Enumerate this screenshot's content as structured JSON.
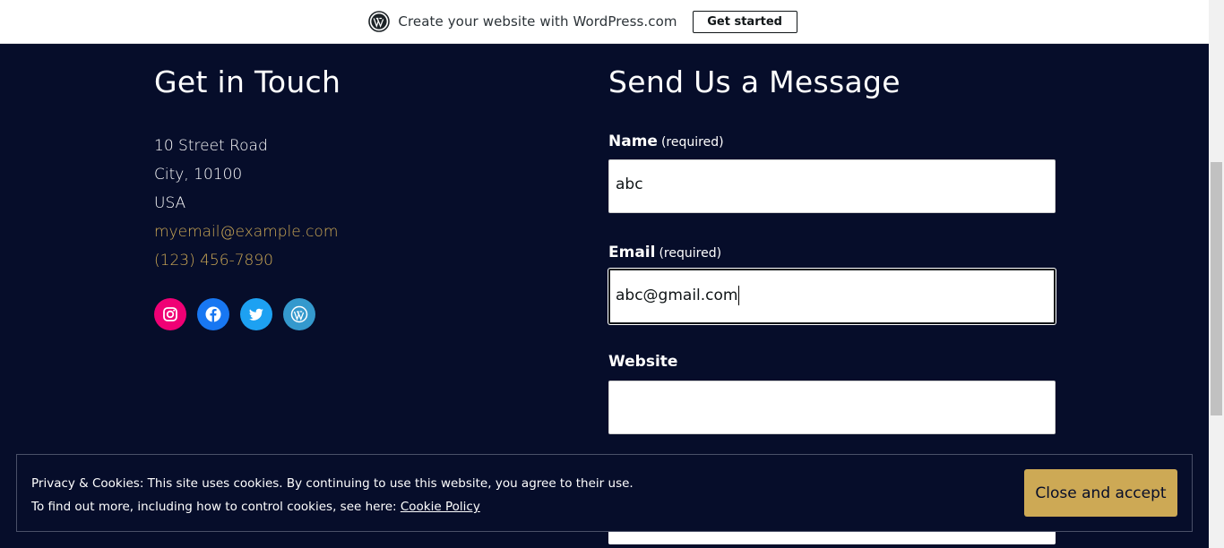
{
  "wp_banner": {
    "text": "Create your website with WordPress.com",
    "button": "Get started"
  },
  "contact": {
    "heading": "Get in Touch",
    "address_line1": "10 Street Road",
    "address_line2": "City, 10100",
    "address_line3": "USA",
    "email": "myemail@example.com",
    "phone": "(123) 456-7890",
    "socials": [
      "instagram-icon",
      "facebook-icon",
      "twitter-icon",
      "wordpress-icon"
    ]
  },
  "form": {
    "heading": "Send Us a Message",
    "name_label": "Name",
    "name_req": "(required)",
    "name_value": "abc",
    "email_label": "Email",
    "email_req": "(required)",
    "email_value": "abc@gmail.com",
    "website_label": "Website",
    "website_value": ""
  },
  "cookie": {
    "line1": "Privacy & Cookies: This site uses cookies. By continuing to use this website, you agree to their use.",
    "line2_prefix": "To find out more, including how to control cookies, see here: ",
    "policy_link": "Cookie Policy",
    "accept": "Close and accept"
  },
  "colors": {
    "background": "#060d2a",
    "accent": "#cda955",
    "instagram": "#f00075",
    "facebook": "#1877f2",
    "twitter": "#1da1f2",
    "wordpress": "#3499cd"
  }
}
